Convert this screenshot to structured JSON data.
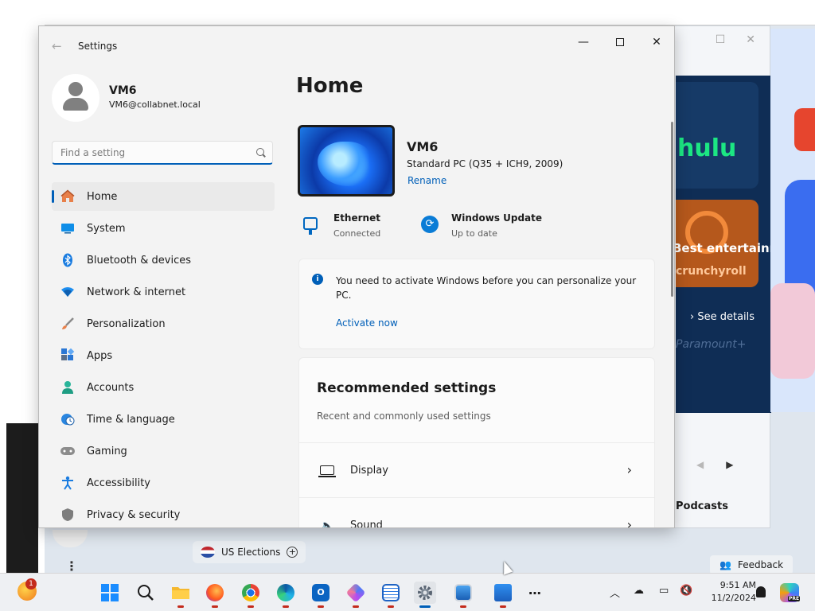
{
  "settings_window": {
    "title": "Settings",
    "user": {
      "name": "VM6",
      "email": "VM6@collabnet.local"
    },
    "search": {
      "placeholder": "Find a setting"
    },
    "nav": [
      {
        "label": "Home",
        "icon": "home-icon",
        "selected": true
      },
      {
        "label": "System",
        "icon": "monitor-icon"
      },
      {
        "label": "Bluetooth & devices",
        "icon": "bluetooth-icon"
      },
      {
        "label": "Network & internet",
        "icon": "wifi-icon"
      },
      {
        "label": "Personalization",
        "icon": "brush-icon"
      },
      {
        "label": "Apps",
        "icon": "apps-icon"
      },
      {
        "label": "Accounts",
        "icon": "person-icon"
      },
      {
        "label": "Time & language",
        "icon": "clock-globe-icon"
      },
      {
        "label": "Gaming",
        "icon": "gamepad-icon"
      },
      {
        "label": "Accessibility",
        "icon": "accessibility-icon"
      },
      {
        "label": "Privacy & security",
        "icon": "shield-icon"
      }
    ],
    "home": {
      "title": "Home",
      "pc": {
        "name": "VM6",
        "model": "Standard PC (Q35 + ICH9, 2009)",
        "rename": "Rename"
      },
      "ethernet": {
        "title": "Ethernet",
        "status": "Connected"
      },
      "windows_update": {
        "title": "Windows Update",
        "status": "Up to date"
      },
      "activation": {
        "message": "You need to activate Windows before you can personalize your PC.",
        "link": "Activate now"
      },
      "recommended": {
        "title": "Recommended settings",
        "subtitle": "Recent and commonly used settings",
        "items": [
          {
            "label": "Display",
            "icon": "display-icon"
          },
          {
            "label": "Sound",
            "icon": "speaker-icon"
          }
        ]
      }
    }
  },
  "store_window": {
    "hero_title": "Best entertainment apps",
    "hero_tile_1": "hulu",
    "hero_tile_2": "crunchyroll",
    "hero_tile_3": "Paramount+",
    "see_details": "See details",
    "podcasts": "Podcasts"
  },
  "widgets": {
    "news_chip": "US Elections",
    "feedback": "Feedback"
  },
  "taskbar": {
    "weather_badge": "1",
    "time": "9:51 AM",
    "date": "11/2/2024",
    "copilot_badge": "PRE"
  },
  "colors": {
    "accent": "#005fb8",
    "settings_bg": "#f3f3f3",
    "taskbar_bg": "#eef0f3"
  }
}
